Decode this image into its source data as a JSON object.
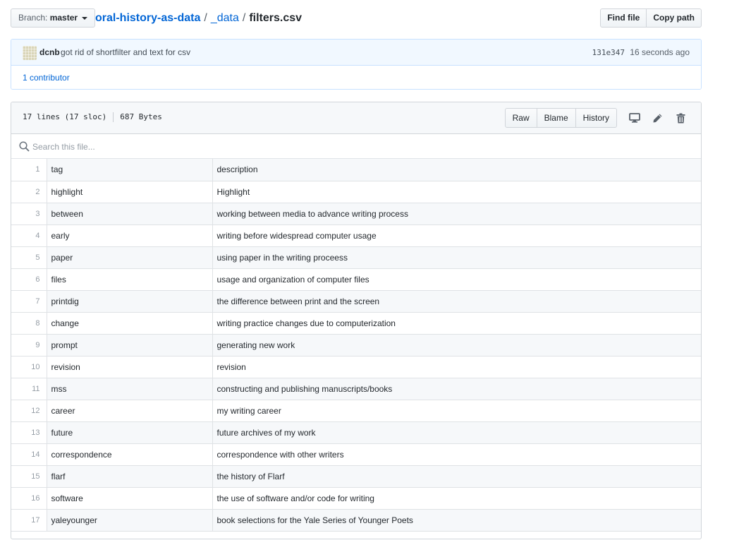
{
  "branch": {
    "label": "Branch:",
    "value": "master"
  },
  "breadcrumb": {
    "repo": "oral-history-as-data",
    "sep": "/",
    "dir": "_data",
    "file": "filters.csv"
  },
  "header_buttons": {
    "find_file": "Find file",
    "copy_path": "Copy path"
  },
  "commit": {
    "author": "dcnb",
    "message": "got rid of shortfilter and text for csv",
    "sha": "131e347",
    "time": "16 seconds ago",
    "contributors": "1 contributor"
  },
  "file": {
    "lines": "17 lines (17 sloc)",
    "size": "687 Bytes",
    "raw": "Raw",
    "blame": "Blame",
    "history": "History",
    "icons": {
      "display": "desktop-icon",
      "edit": "pencil-icon",
      "delete": "trash-icon"
    }
  },
  "search": {
    "placeholder": "Search this file..."
  },
  "table": {
    "rows": [
      {
        "ln": "1",
        "tag": "tag",
        "description": "description"
      },
      {
        "ln": "2",
        "tag": "highlight",
        "description": "Highlight"
      },
      {
        "ln": "3",
        "tag": "between",
        "description": "working between media to advance writing process"
      },
      {
        "ln": "4",
        "tag": "early",
        "description": "writing before widespread computer usage"
      },
      {
        "ln": "5",
        "tag": "paper",
        "description": "using paper in the writing proceess"
      },
      {
        "ln": "6",
        "tag": "files",
        "description": "usage and organization of computer files"
      },
      {
        "ln": "7",
        "tag": "printdig",
        "description": "the difference between print and the screen"
      },
      {
        "ln": "8",
        "tag": "change",
        "description": "writing practice changes due to computerization"
      },
      {
        "ln": "9",
        "tag": "prompt",
        "description": "generating new work"
      },
      {
        "ln": "10",
        "tag": "revision",
        "description": "revision"
      },
      {
        "ln": "11",
        "tag": "mss",
        "description": "constructing and publishing manuscripts/books"
      },
      {
        "ln": "12",
        "tag": "career",
        "description": "my writing career"
      },
      {
        "ln": "13",
        "tag": "future",
        "description": "future archives of my work"
      },
      {
        "ln": "14",
        "tag": "correspondence",
        "description": "correspondence with other writers"
      },
      {
        "ln": "15",
        "tag": "flarf",
        "description": "the history of Flarf"
      },
      {
        "ln": "16",
        "tag": "software",
        "description": "the use of software and/or code for writing"
      },
      {
        "ln": "17",
        "tag": "yaleyounger",
        "description": "book selections for the Yale Series of Younger Poets"
      }
    ]
  }
}
